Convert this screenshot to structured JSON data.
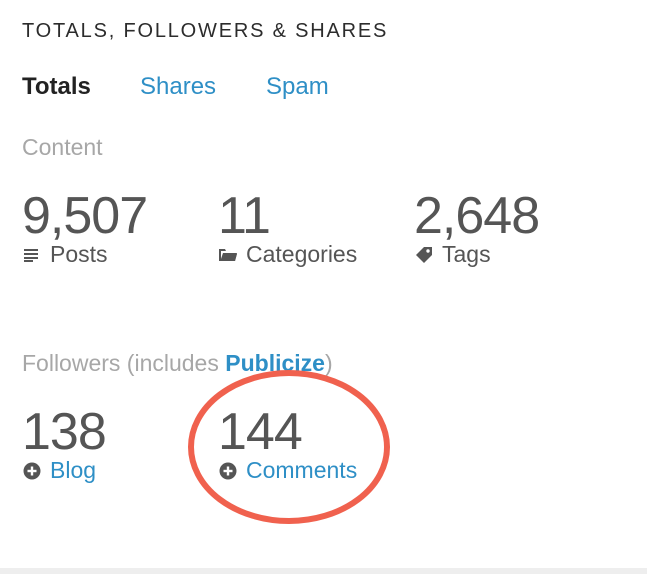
{
  "header": {
    "title": "TOTALS, FOLLOWERS & SHARES"
  },
  "tabs": [
    {
      "label": "Totals",
      "active": true
    },
    {
      "label": "Shares",
      "active": false
    },
    {
      "label": "Spam",
      "active": false
    }
  ],
  "content": {
    "heading": "Content",
    "stats": [
      {
        "value": "9,507",
        "label": "Posts",
        "icon": "posts-icon"
      },
      {
        "value": "11",
        "label": "Categories",
        "icon": "folder-icon"
      },
      {
        "value": "2,648",
        "label": "Tags",
        "icon": "tag-icon"
      }
    ]
  },
  "followers": {
    "heading_prefix": "Followers (includes ",
    "heading_link": "Publicize",
    "heading_suffix": ")",
    "stats": [
      {
        "value": "138",
        "label": "Blog",
        "icon": "plus-circle-icon"
      },
      {
        "value": "144",
        "label": "Comments",
        "icon": "plus-circle-icon"
      }
    ]
  },
  "colors": {
    "link": "#2e8fc6",
    "muted": "#a7a7a7",
    "annotation": "#f0614e"
  }
}
